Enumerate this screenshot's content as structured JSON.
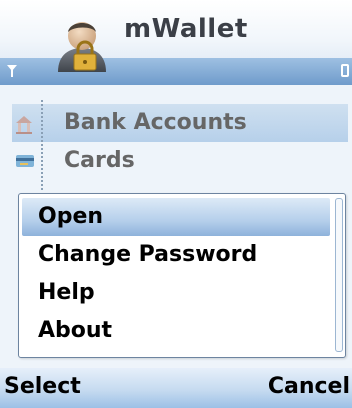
{
  "app": {
    "title": "mWallet"
  },
  "list": {
    "items": [
      {
        "label": "Bank Accounts",
        "icon": "bank-icon"
      },
      {
        "label": "Cards",
        "icon": "card-icon"
      }
    ]
  },
  "menu": {
    "items": [
      {
        "label": "Open"
      },
      {
        "label": "Change Password"
      },
      {
        "label": "Help"
      },
      {
        "label": "About"
      }
    ]
  },
  "softkeys": {
    "left": "Select",
    "right": "Cancel"
  },
  "colors": {
    "accent": "#8eb2db",
    "status_strip": "#6f9bcb"
  }
}
